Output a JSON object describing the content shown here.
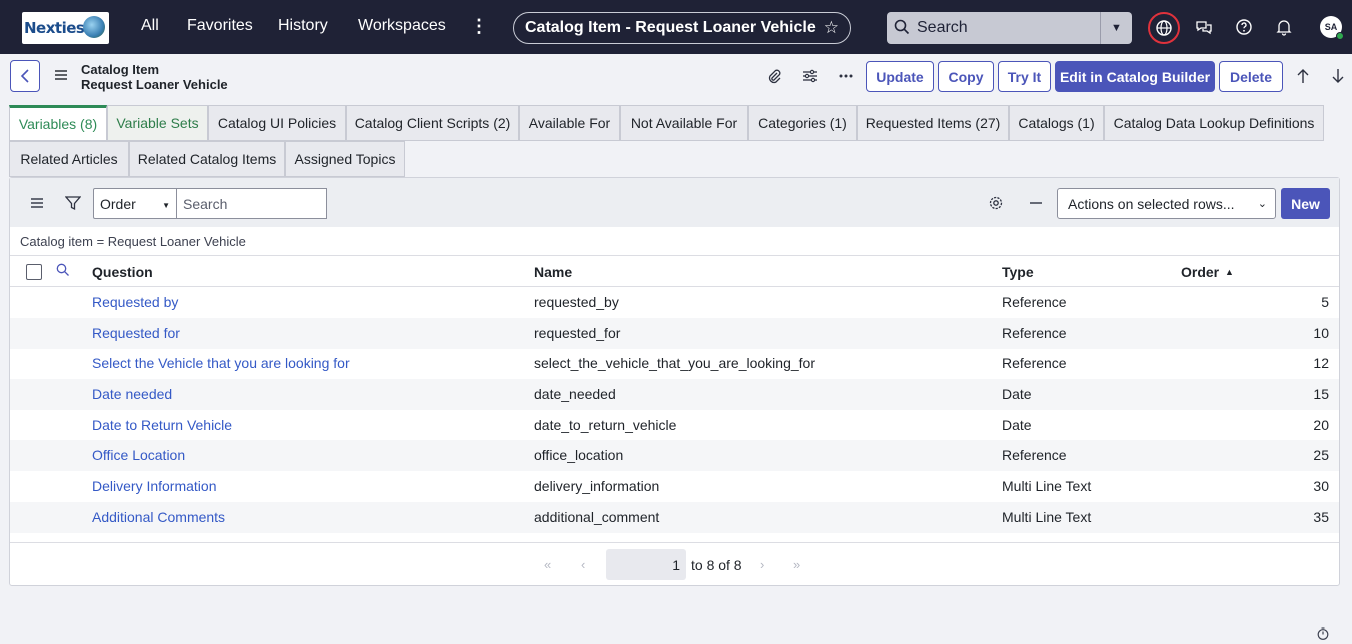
{
  "topnav": {
    "logo_text": "Nexties",
    "links": [
      "All",
      "Favorites",
      "History",
      "Workspaces"
    ],
    "more_label": "⋮",
    "context_title": "Catalog Item - Request Loaner Vehicle",
    "search_label": "Search",
    "avatar_initials": "SA"
  },
  "form": {
    "title_line1": "Catalog Item",
    "title_line2": "Request Loaner Vehicle",
    "buttons": {
      "update": "Update",
      "copy": "Copy",
      "try_it": "Try It",
      "edit_builder": "Edit in Catalog Builder",
      "delete": "Delete"
    }
  },
  "tabs_row1": [
    "Variables (8)",
    "Variable Sets",
    "Catalog UI Policies",
    "Catalog Client Scripts (2)",
    "Available For",
    "Not Available For",
    "Categories (1)",
    "Requested Items (27)",
    "Catalogs (1)",
    "Catalog Data Lookup Definitions"
  ],
  "tabs_row2": [
    "Related Articles",
    "Related Catalog Items",
    "Assigned Topics"
  ],
  "list": {
    "order_select": "Order",
    "search_placeholder": "Search",
    "actions_select": "Actions on selected rows...",
    "new_label": "New",
    "breadcrumb": "Catalog item = Request Loaner Vehicle",
    "columns": {
      "question": "Question",
      "name": "Name",
      "type": "Type",
      "order": "Order"
    },
    "sort_indicator": "▲",
    "rows": [
      {
        "question": "Requested by",
        "name": "requested_by",
        "type": "Reference",
        "order": "5"
      },
      {
        "question": "Requested for",
        "name": "requested_for",
        "type": "Reference",
        "order": "10"
      },
      {
        "question": "Select the Vehicle that you are looking for",
        "name": "select_the_vehicle_that_you_are_looking_for",
        "type": "Reference",
        "order": "12"
      },
      {
        "question": "Date needed",
        "name": "date_needed",
        "type": "Date",
        "order": "15"
      },
      {
        "question": "Date to Return Vehicle",
        "name": "date_to_return_vehicle",
        "type": "Date",
        "order": "20"
      },
      {
        "question": "Office Location",
        "name": "office_location",
        "type": "Reference",
        "order": "25"
      },
      {
        "question": "Delivery Information",
        "name": "delivery_information",
        "type": "Multi Line Text",
        "order": "30"
      },
      {
        "question": "Additional Comments",
        "name": "additional_comment",
        "type": "Multi Line Text",
        "order": "35"
      }
    ],
    "pager": {
      "current": "1",
      "range_text": "to 8 of 8"
    }
  },
  "colors": {
    "nav_bg": "#1f2236",
    "accent": "#4b55b9",
    "link": "#3459c6",
    "active_tab": "#2e8b57"
  }
}
